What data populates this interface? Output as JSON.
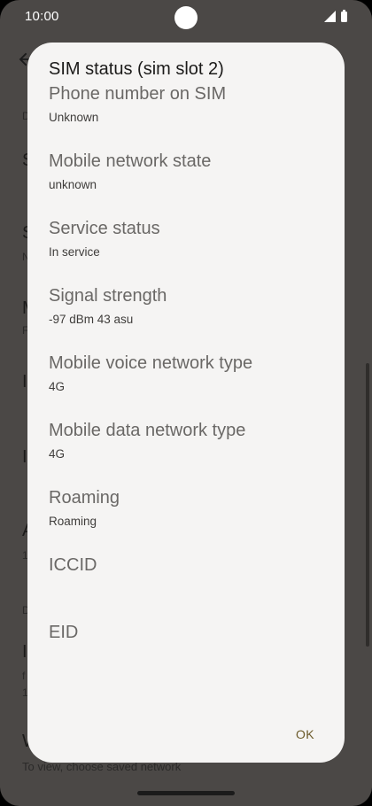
{
  "status_bar": {
    "time": "10:00",
    "icons": [
      "signal-icon",
      "battery-icon"
    ]
  },
  "background": {
    "fragments": [
      "D",
      "S",
      "S",
      "N",
      "M",
      "F",
      "I",
      "I",
      "A",
      "1",
      "D",
      "I",
      "f",
      "1"
    ],
    "bottom_title": "W",
    "bottom_subtitle": "To view, choose saved network"
  },
  "dialog": {
    "title": "SIM status (sim slot 2)",
    "items": [
      {
        "label": "Phone number on SIM",
        "value": "Unknown"
      },
      {
        "label": "Mobile network state",
        "value": "unknown"
      },
      {
        "label": "Service status",
        "value": "In service"
      },
      {
        "label": "Signal strength",
        "value": "-97 dBm 43 asu"
      },
      {
        "label": "Mobile voice network type",
        "value": "4G"
      },
      {
        "label": "Mobile data network type",
        "value": "4G"
      },
      {
        "label": "Roaming",
        "value": "Roaming"
      },
      {
        "label": "ICCID",
        "value": ""
      },
      {
        "label": "EID",
        "value": ""
      }
    ],
    "ok_label": "OK"
  },
  "colors": {
    "scrim": "#4b4846",
    "dialog_bg": "#f5f4f3",
    "accent": "#6b5a2a"
  }
}
